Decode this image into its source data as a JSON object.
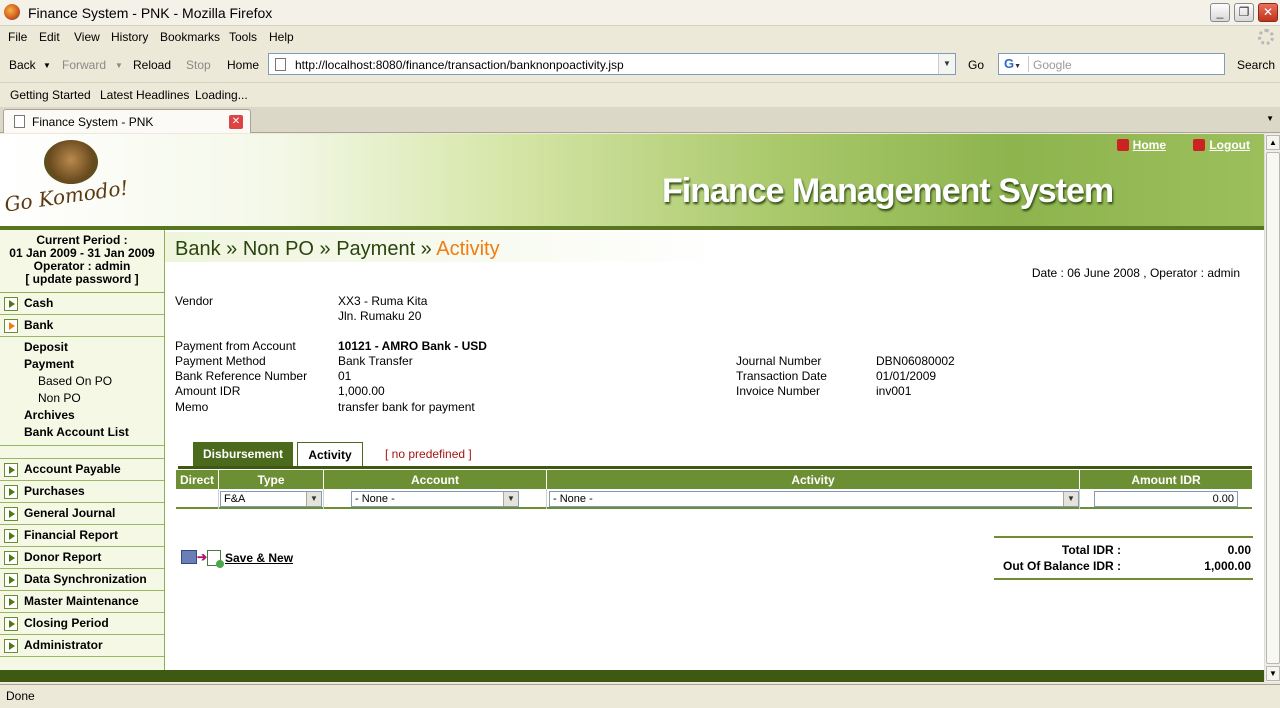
{
  "window": {
    "title": "Finance System - PNK - Mozilla Firefox"
  },
  "menu": [
    "File",
    "Edit",
    "View",
    "History",
    "Bookmarks",
    "Tools",
    "Help"
  ],
  "nav": {
    "back": "Back",
    "forward": "Forward",
    "reload": "Reload",
    "stop": "Stop",
    "home": "Home",
    "url": "http://localhost:8080/finance/transaction/banknonpoactivity.jsp",
    "go": "Go",
    "search_placeholder": "Google",
    "search": "Search"
  },
  "bookmarks": [
    "Getting Started",
    "Latest Headlines",
    "Loading..."
  ],
  "tab": {
    "title": "Finance System - PNK"
  },
  "status": "Done",
  "header": {
    "logo": "Go Komodo!",
    "home": "Home",
    "logout": "Logout",
    "title": "Finance Management System"
  },
  "sidebar": {
    "period_label": "Current Period :",
    "period": "01 Jan 2009 - 31 Jan 2009",
    "operator": "Operator : admin",
    "update": "[ update password ]",
    "cash": "Cash",
    "bank": "Bank",
    "bank_sub": [
      "Deposit",
      "Payment",
      "Based On PO",
      "Non PO",
      "Archives",
      "Bank Account List"
    ],
    "items": [
      "Account Payable",
      "Purchases",
      "General Journal",
      "Financial Report",
      "Donor Report",
      "Data Synchronization",
      "Master Maintenance",
      "Closing Period",
      "Administrator"
    ]
  },
  "crumb": {
    "path": "Bank » Non PO » Payment » ",
    "current": "Activity"
  },
  "dateop": "Date : 06 June 2008 ,  Operator : admin",
  "form": {
    "vendor_label": "Vendor",
    "vendor_name": "XX3 - Ruma Kita",
    "vendor_addr": "Jln. Rumaku 20",
    "pfa_label": "Payment from Account",
    "pfa": "10121 - AMRO Bank - USD",
    "pm_label": "Payment Method",
    "pm": "Bank Transfer",
    "brn_label": "Bank Reference Number",
    "brn": "01",
    "amt_label": "Amount IDR",
    "amt": "1,000.00",
    "memo_label": "Memo",
    "memo": "transfer bank for payment",
    "jn_label": "Journal Number",
    "jn": "DBN06080002",
    "td_label": "Transaction Date",
    "td": "01/01/2009",
    "inv_label": "Invoice Number",
    "inv": "inv001"
  },
  "tabs": {
    "disbursement": "Disbursement",
    "activity": "Activity",
    "nopredef": "[ no predefined ]"
  },
  "grid": {
    "headers": [
      "Direct",
      "Type",
      "Account",
      "Activity",
      "Amount IDR"
    ],
    "type_value": "F&A",
    "account_value": "- None -",
    "activity_value": "- None -",
    "amount_value": "0.00"
  },
  "save_label": "Save & New",
  "totals": {
    "total_label": "Total IDR :",
    "total": "0.00",
    "oob_label": "Out Of Balance IDR :",
    "oob": "1,000.00"
  }
}
